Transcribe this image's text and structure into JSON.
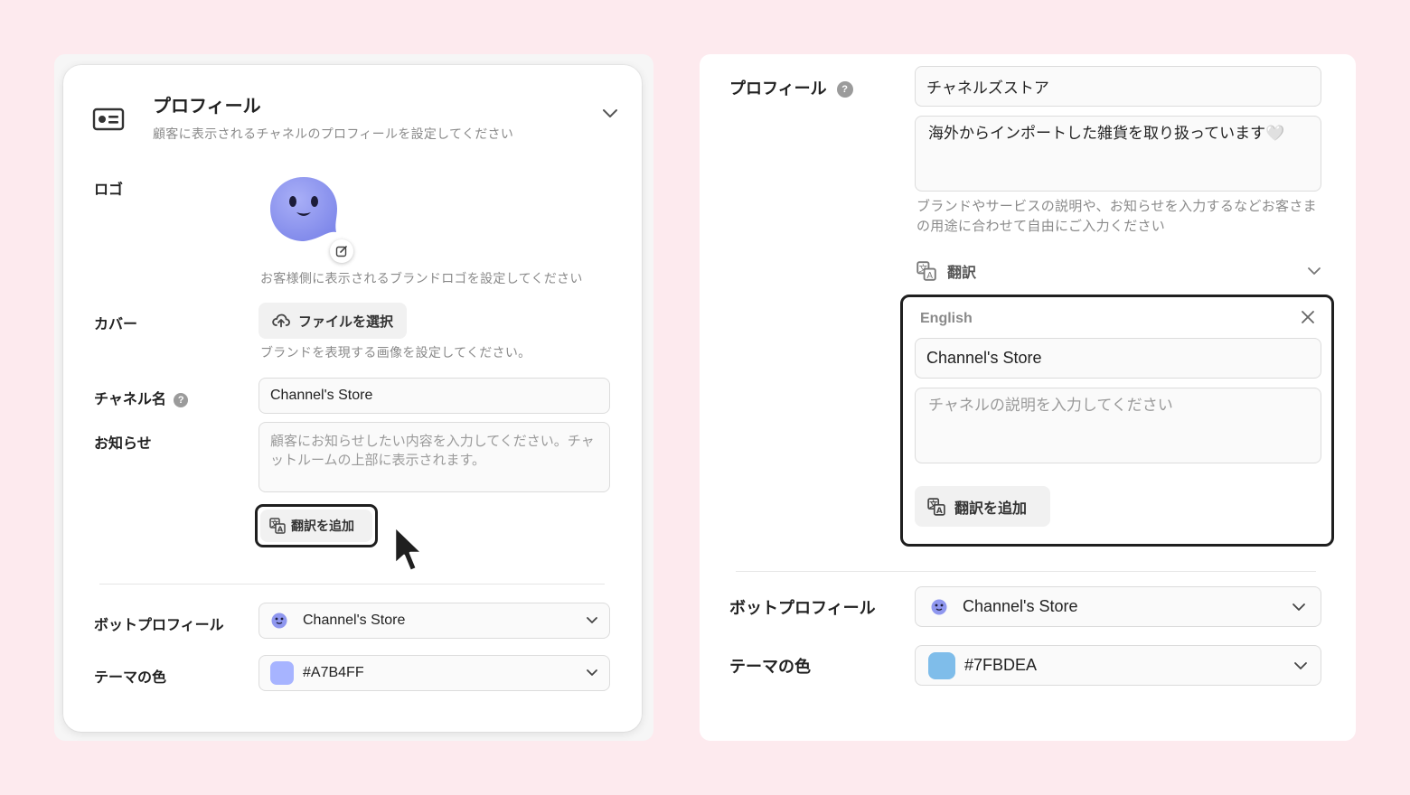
{
  "left": {
    "header": {
      "title": "プロフィール",
      "subtitle": "顧客に表示されるチャネルのプロフィールを設定してください"
    },
    "logo": {
      "label": "ロゴ",
      "hint": "お客様側に表示されるブランドロゴを設定してください"
    },
    "cover": {
      "label": "カバー",
      "button_label": "ファイルを選択",
      "hint": "ブランドを表現する画像を設定してください。"
    },
    "channel_name": {
      "label": "チャネル名",
      "help": "?",
      "value": "Channel's Store"
    },
    "notice": {
      "label": "お知らせ",
      "placeholder": "顧客にお知らせしたい内容を入力してください。チャットルームの上部に表示されます。"
    },
    "add_translation_label": "翻訳を追加",
    "bot_profile": {
      "label": "ボットプロフィール",
      "value": "Channel's Store"
    },
    "theme_color": {
      "label": "テーマの色",
      "value": "#A7B4FF",
      "swatch": "#A7B4FF"
    }
  },
  "right": {
    "profile": {
      "label": "プロフィール",
      "help": "?",
      "name_value": "チャネルズストア",
      "description_value": "海外からインポートした雑貨を取り扱っています🤍",
      "hint": "ブランドやサービスの説明や、お知らせを入力するなどお客さまの用途に合わせて自由にご入力ください"
    },
    "translation": {
      "label": "翻訳",
      "language": "English",
      "name_value": "Channel's Store",
      "description_placeholder": "チャネルの説明を入力してください",
      "add_translation_label": "翻訳を追加"
    },
    "bot_profile": {
      "label": "ボットプロフィール",
      "value": "Channel's Store"
    },
    "theme_color": {
      "label": "テーマの色",
      "value": "#7FBDEA",
      "swatch": "#7FBDEA"
    }
  },
  "colors": {
    "background": "#FDEAEE",
    "mascot": "#8E96EE",
    "highlight_border": "#1F1F1F"
  }
}
